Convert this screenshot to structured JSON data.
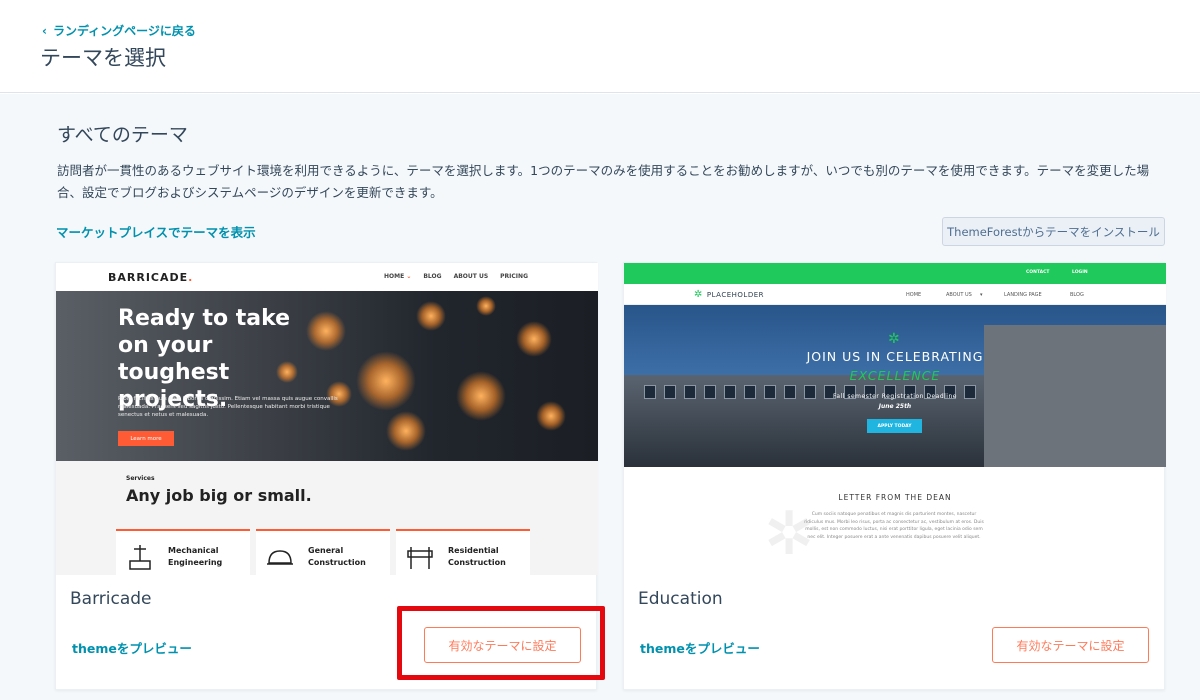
{
  "header": {
    "back_label": "ランディングページに戻る",
    "title": "テーマを選択"
  },
  "section": {
    "title": "すべてのテーマ",
    "description": "訪問者が一貫性のあるウェブサイト環境を利用できるように、テーマを選択します。1つのテーマのみを使用することをお勧めしますが、いつでも別のテーマを使用できます。テーマを変更した場合、設定でブログおよびシステムページのデザインを更新できます。",
    "marketplace_link": "マーケットプレイスでテーマを表示",
    "install_button": "ThemeForestからテーマをインストール"
  },
  "themes": [
    {
      "name": "Barricade",
      "preview_label": "themeをプレビュー",
      "set_label": "有効なテーマに設定",
      "thumbnail": {
        "logo": "BARRICADE",
        "logo_dot": ".",
        "menu": [
          "HOME",
          "BLOG",
          "ABOUT US",
          "PRICING"
        ],
        "hero_title": "Ready to take on your toughest projects.",
        "hero_text": "Proin facilisis quis ante lobortis dignissim. Etiam vel massa quis augue convallis malesuada. Praesent sed sagittis justo. Pellentesque habitant morbi tristique senectus et netus et malesuada.",
        "hero_button": "Learn more",
        "services_label": "Services",
        "services_title": "Any job big or small.",
        "services": [
          {
            "label": "Mechanical Engineering",
            "icon": "crane-icon"
          },
          {
            "label": "General Construction",
            "icon": "hardhat-icon"
          },
          {
            "label": "Residential Construction",
            "icon": "barrier-icon"
          }
        ]
      }
    },
    {
      "name": "Education",
      "preview_label": "themeをプレビュー",
      "set_label": "有効なテーマに設定",
      "thumbnail": {
        "topbar": [
          "CONTACT",
          "LOGIN"
        ],
        "logo": "PLACEHOLDER",
        "menu": [
          "HOME",
          "ABOUT US",
          "LANDING PAGE",
          "BLOG"
        ],
        "hero_line1": "JOIN US IN CELEBRATING",
        "hero_line2": "EXCELLENCE",
        "hero_sub1": "Fall semester Registration Deadline",
        "hero_sub2": "June 25th",
        "apply_button": "APPLY TODAY",
        "letter_title": "LETTER FROM THE DEAN",
        "letter_text": "Cum sociis natoque penatibus et magnis dis parturient montes, nascetur ridiculus mus. Morbi leo risus, porta ac consectetur ac, vestibulum at eros. Duis mollis, est non commodo luctus, nisi erat porttitor ligula, eget lacinia odio sem nec elit. Integer posuere erat a ante venenatis dapibus posuere velit aliquet."
      }
    }
  ],
  "colors": {
    "link": "#0091ae",
    "accent": "#ff7a59",
    "highlight": "#e4090f"
  }
}
